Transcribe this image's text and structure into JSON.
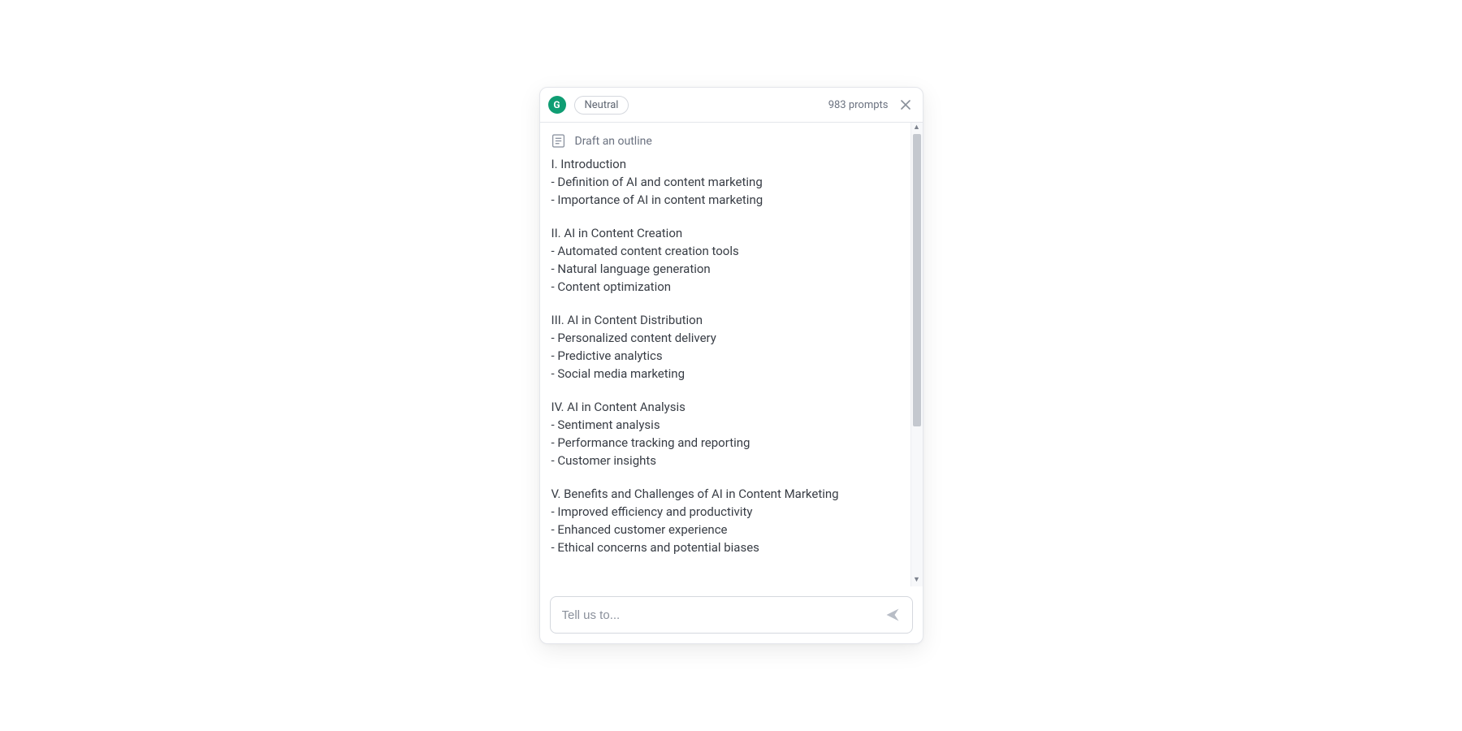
{
  "header": {
    "logo_letter": "G",
    "tone_label": "Neutral",
    "prompt_count_text": "983 prompts"
  },
  "document": {
    "action_title": "Draft an outline"
  },
  "outline": {
    "sections": [
      {
        "heading": "I. Introduction",
        "items": [
          "- Definition of AI and content marketing",
          "- Importance of AI in content marketing"
        ]
      },
      {
        "heading": "II. AI in Content Creation",
        "items": [
          "- Automated content creation tools",
          "- Natural language generation",
          "- Content optimization"
        ]
      },
      {
        "heading": "III. AI in Content Distribution",
        "items": [
          "- Personalized content delivery",
          "- Predictive analytics",
          "- Social media marketing"
        ]
      },
      {
        "heading": "IV. AI in Content Analysis",
        "items": [
          "- Sentiment analysis",
          "- Performance tracking and reporting",
          "- Customer insights"
        ]
      },
      {
        "heading": "V. Benefits and Challenges of AI in Content Marketing",
        "items": [
          "- Improved efficiency and productivity",
          "- Enhanced customer experience",
          "- Ethical concerns and potential biases"
        ]
      }
    ]
  },
  "composer": {
    "placeholder": "Tell us to..."
  }
}
